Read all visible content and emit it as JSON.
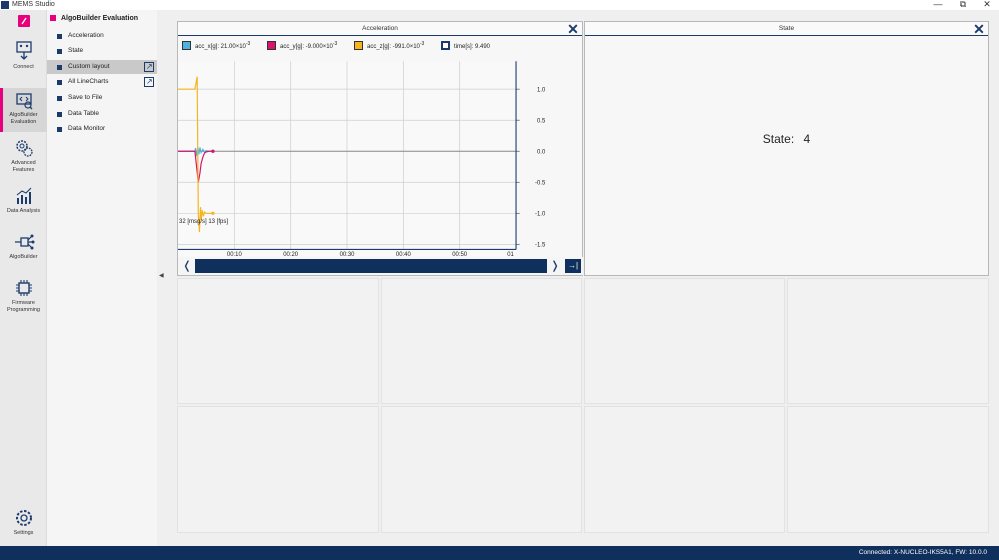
{
  "window": {
    "title": "MEMS Studio",
    "minimize": "—",
    "maximize": "⧉",
    "close": "✕"
  },
  "rail": {
    "items": [
      {
        "label": "Connect"
      },
      {
        "label": "AlgoBuilder Evaluation"
      },
      {
        "label": "Advanced Features"
      },
      {
        "label": "Data Analysis"
      },
      {
        "label": "AlgoBuilder"
      },
      {
        "label": "Firmware Programming"
      },
      {
        "label": "Settings"
      }
    ]
  },
  "subnav": {
    "title": "AlgoBuilder Evaluation",
    "items": [
      {
        "label": "Acceleration"
      },
      {
        "label": "State"
      },
      {
        "label": "Custom layout"
      },
      {
        "label": "All LineCharts"
      },
      {
        "label": "Save to File"
      },
      {
        "label": "Data Table"
      },
      {
        "label": "Data Monitor"
      }
    ],
    "selected": "Custom layout"
  },
  "acceleration_panel": {
    "title": "Acceleration",
    "legend": [
      {
        "text": "acc_x[g]: 21.00×10",
        "exp": "-3",
        "color": "#4fb3df"
      },
      {
        "text": "acc_y[g]: -9.000×10",
        "exp": "-3",
        "color": "#d8146c"
      },
      {
        "text": "acc_z[g]: -991.0×10",
        "exp": "-3",
        "color": "#f5b51e"
      },
      {
        "text": "time[s]: 9.490",
        "exp": "",
        "color": "#1c3b6b"
      }
    ],
    "fps_text": "32 [msg/s] 13 [fps]",
    "scroll_left": "❬",
    "scroll_right": "❭",
    "scroll_end": "→|"
  },
  "state_panel": {
    "title": "State",
    "label": "State:",
    "value": "4"
  },
  "chart_data": {
    "type": "line",
    "x_tick_labels": [
      "00:10",
      "00:20",
      "00:30",
      "00:40",
      "00:50",
      "01"
    ],
    "y_tick_labels": [
      "1.0",
      "0.5",
      "0.0",
      "-0.5",
      "-1.0",
      "-1.5"
    ],
    "ylim": [
      -1.5,
      1.0
    ],
    "grid": true,
    "series": [
      {
        "name": "acc_x[g]",
        "color": "#4fb3df",
        "x": [
          0,
          3.0,
          3.1,
          3.3,
          3.5,
          3.7,
          3.9,
          4.1,
          4.4,
          4.7,
          5.0,
          5.5,
          6.2
        ],
        "values": [
          0.0,
          0.0,
          0.05,
          -0.08,
          0.07,
          -0.05,
          0.06,
          -0.02,
          0.03,
          -0.01,
          0.01,
          0.0,
          0.0
        ]
      },
      {
        "name": "acc_y[g]",
        "color": "#d8146c",
        "x": [
          0,
          3.0,
          3.3,
          3.6,
          3.9,
          4.1,
          4.4,
          4.7,
          5.0,
          5.5,
          6.2
        ],
        "values": [
          0.0,
          0.0,
          -0.25,
          -0.5,
          -0.35,
          -0.2,
          -0.1,
          -0.03,
          -0.01,
          0.0,
          0.0
        ]
      },
      {
        "name": "acc_z[g]",
        "color": "#f5b51e",
        "x": [
          0,
          3.0,
          3.4,
          3.6,
          3.8,
          4.0,
          4.1,
          4.3,
          4.5,
          4.7,
          5.0,
          5.5,
          6.2
        ],
        "values": [
          1.0,
          1.0,
          1.2,
          -1.0,
          -1.3,
          -0.9,
          -1.1,
          -0.95,
          -1.05,
          -0.98,
          -1.0,
          -1.0,
          -1.0
        ]
      }
    ]
  },
  "statusbar": {
    "text": "Connected:  X-NUCLEO-IKS5A1, FW: 10.0.0"
  }
}
